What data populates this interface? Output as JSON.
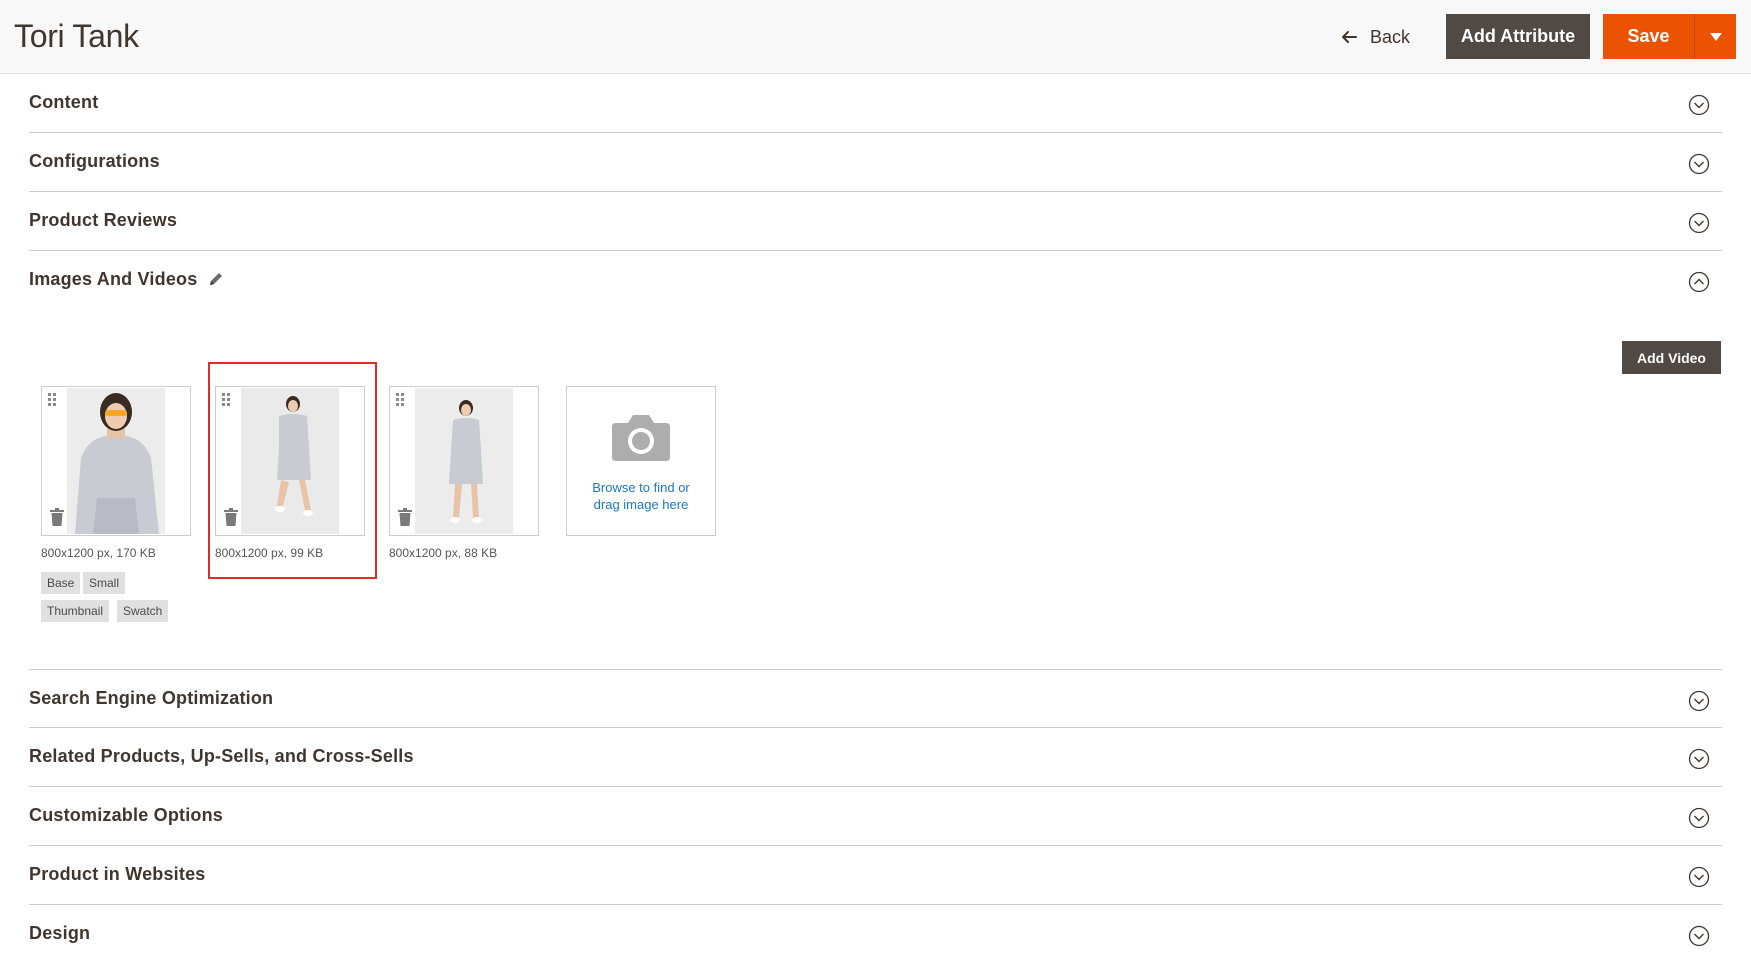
{
  "header": {
    "title": "Tori Tank",
    "back_label": "Back",
    "add_attribute_label": "Add Attribute",
    "save_label": "Save"
  },
  "sections_top": [
    {
      "label": "Content",
      "expanded": false
    },
    {
      "label": "Configurations",
      "expanded": false
    },
    {
      "label": "Product Reviews",
      "expanded": false
    },
    {
      "label": "Images And Videos",
      "expanded": true
    }
  ],
  "images": {
    "add_video_label": "Add Video",
    "items": [
      {
        "meta": "800x1200 px, 170 KB",
        "roles": [
          "Base",
          "Small",
          "Thumbnail",
          "Swatch"
        ]
      },
      {
        "meta": "800x1200 px, 99 KB",
        "roles": []
      },
      {
        "meta": "800x1200 px, 88 KB",
        "roles": []
      }
    ],
    "upload_text_line1": "Browse to find or",
    "upload_text_line2": "drag image here"
  },
  "sections_bottom": [
    {
      "label": "Search Engine Optimization",
      "expanded": false
    },
    {
      "label": "Related Products, Up-Sells, and Cross-Sells",
      "expanded": false
    },
    {
      "label": "Customizable Options",
      "expanded": false
    },
    {
      "label": "Product in Websites",
      "expanded": false
    },
    {
      "label": "Design",
      "expanded": false
    }
  ],
  "colors": {
    "accent_orange": "#eb5202",
    "dark_button": "#514943",
    "link_blue": "#1979c3",
    "highlight_red": "#e02b27"
  },
  "icons": {
    "back": "arrow-left-icon",
    "save_dropdown": "caret-down-icon",
    "section_collapsed": "chevron-down-circle-icon",
    "section_expanded": "chevron-up-circle-icon",
    "edit": "pencil-icon",
    "drag": "drag-handle-icon",
    "delete": "trash-icon",
    "upload": "camera-icon"
  }
}
